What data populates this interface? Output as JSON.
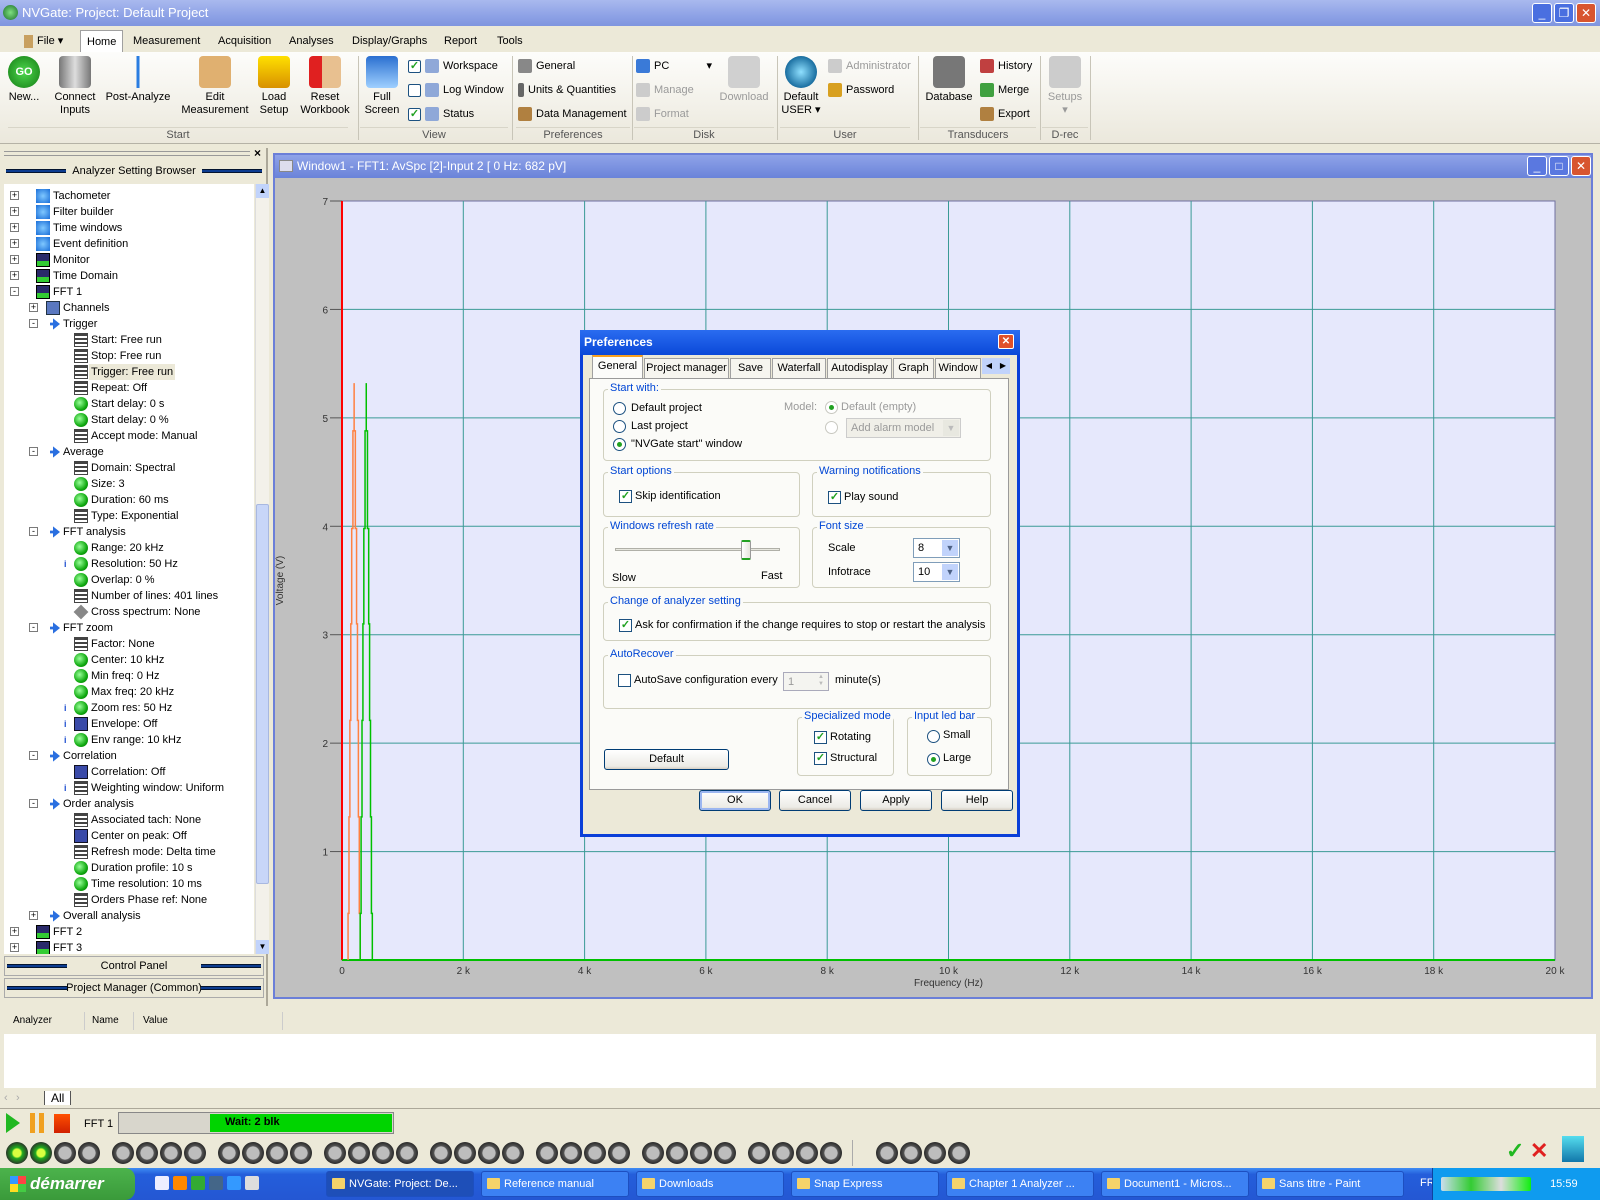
{
  "window": {
    "title": "NVGate: Project: Default Project"
  },
  "menu": {
    "file": "File",
    "tabs": [
      "Home",
      "Measurement",
      "Acquisition",
      "Analyses",
      "Display/Graphs",
      "Report",
      "Tools"
    ],
    "active": "Home"
  },
  "ribbon": {
    "start": {
      "label": "Start",
      "new": "New...",
      "connect": "Connect Inputs",
      "post": "Post-Analyze",
      "edit": "Edit Measurement",
      "load": "Load Setup",
      "reset": "Reset Workbook"
    },
    "view": {
      "label": "View",
      "full": "Full Screen",
      "workspace": "Workspace",
      "workspace_checked": true,
      "log": "Log Window",
      "log_checked": false,
      "status": "Status",
      "status_checked": true
    },
    "preferences": {
      "label": "Preferences",
      "general": "General",
      "units": "Units & Quantities",
      "data": "Data Management"
    },
    "disk": {
      "label": "Disk",
      "pc": "PC",
      "manage": "Manage",
      "format": "Format",
      "download": "Download"
    },
    "user": {
      "label": "User",
      "default": "Default USER",
      "admin": "Administrator",
      "password": "Password"
    },
    "transducers": {
      "label": "Transducers",
      "database": "Database",
      "history": "History",
      "merge": "Merge",
      "export": "Export"
    },
    "drec": {
      "label": "D-rec",
      "setups": "Setups"
    }
  },
  "left_panel": {
    "title": "Analyzer Setting Browser",
    "control_panel": "Control Panel",
    "project_manager": "Project Manager (Common)",
    "tree": [
      {
        "label": "Tachometer",
        "level": 0,
        "exp": "+",
        "icon": "gear"
      },
      {
        "label": "Filter builder",
        "level": 0,
        "exp": "+",
        "icon": "gear"
      },
      {
        "label": "Time windows",
        "level": 0,
        "exp": "+",
        "icon": "gear"
      },
      {
        "label": "Event definition",
        "level": 0,
        "exp": "+",
        "icon": "gear"
      },
      {
        "label": "Monitor",
        "level": 0,
        "exp": "+",
        "icon": "scope"
      },
      {
        "label": "Time Domain",
        "level": 0,
        "exp": "+",
        "icon": "scope"
      },
      {
        "label": "FFT 1",
        "level": 0,
        "exp": "-",
        "icon": "scope"
      },
      {
        "label": "Channels",
        "level": 1,
        "exp": "+",
        "icon": "channels"
      },
      {
        "label": "Trigger",
        "level": 1,
        "exp": "-",
        "icon": "arrow"
      },
      {
        "label": "Start: Free run",
        "level": 2,
        "icon": "list"
      },
      {
        "label": "Stop: Free run",
        "level": 2,
        "icon": "list"
      },
      {
        "label": "Trigger: Free run",
        "level": 2,
        "icon": "list",
        "selected": true
      },
      {
        "label": "Repeat: Off",
        "level": 2,
        "icon": "list"
      },
      {
        "label": "Start delay: 0 s",
        "level": 2,
        "icon": "knob"
      },
      {
        "label": "Start delay: 0 %",
        "level": 2,
        "icon": "knob"
      },
      {
        "label": "Accept mode: Manual",
        "level": 2,
        "icon": "list"
      },
      {
        "label": "Average",
        "level": 1,
        "exp": "-",
        "icon": "arrow"
      },
      {
        "label": "Domain: Spectral",
        "level": 2,
        "icon": "list"
      },
      {
        "label": "Size: 3",
        "level": 2,
        "icon": "knob"
      },
      {
        "label": "Duration: 60 ms",
        "level": 2,
        "icon": "knob"
      },
      {
        "label": "Type: Exponential",
        "level": 2,
        "icon": "list"
      },
      {
        "label": "FFT analysis",
        "level": 1,
        "exp": "-",
        "icon": "arrow"
      },
      {
        "label": "Range: 20 kHz",
        "level": 2,
        "icon": "knob"
      },
      {
        "label": "Resolution: 50 Hz",
        "level": 2,
        "icon": "knob",
        "info": true
      },
      {
        "label": "Overlap: 0 %",
        "level": 2,
        "icon": "knob"
      },
      {
        "label": "Number of lines: 401 lines",
        "level": 2,
        "icon": "list"
      },
      {
        "label": "Cross spectrum: None",
        "level": 2,
        "icon": "diamond"
      },
      {
        "label": "FFT zoom",
        "level": 1,
        "exp": "-",
        "icon": "arrow"
      },
      {
        "label": "Factor: None",
        "level": 2,
        "icon": "list"
      },
      {
        "label": "Center: 10 kHz",
        "level": 2,
        "icon": "knob"
      },
      {
        "label": "Min freq: 0 Hz",
        "level": 2,
        "icon": "knob"
      },
      {
        "label": "Max freq: 20 kHz",
        "level": 2,
        "icon": "knob"
      },
      {
        "label": "Zoom res: 50 Hz",
        "level": 2,
        "icon": "knob",
        "info": true
      },
      {
        "label": "Envelope: Off",
        "level": 2,
        "icon": "square",
        "info": true
      },
      {
        "label": "Env range: 10 kHz",
        "level": 2,
        "icon": "knob",
        "info": true
      },
      {
        "label": "Correlation",
        "level": 1,
        "exp": "-",
        "icon": "arrow"
      },
      {
        "label": "Correlation: Off",
        "level": 2,
        "icon": "square"
      },
      {
        "label": "Weighting window: Uniform",
        "level": 2,
        "icon": "list",
        "info": true
      },
      {
        "label": "Order analysis",
        "level": 1,
        "exp": "-",
        "icon": "arrow"
      },
      {
        "label": "Associated tach: None",
        "level": 2,
        "icon": "list"
      },
      {
        "label": "Center on peak: Off",
        "level": 2,
        "icon": "square"
      },
      {
        "label": "Refresh mode: Delta time",
        "level": 2,
        "icon": "list"
      },
      {
        "label": "Duration profile: 10 s",
        "level": 2,
        "icon": "knob"
      },
      {
        "label": "Time resolution: 10 ms",
        "level": 2,
        "icon": "knob"
      },
      {
        "label": "Orders Phase ref: None",
        "level": 2,
        "icon": "list"
      },
      {
        "label": "Overall analysis",
        "level": 1,
        "exp": "+",
        "icon": "arrow"
      },
      {
        "label": "FFT 2",
        "level": 0,
        "exp": "+",
        "icon": "scope"
      },
      {
        "label": "FFT 3",
        "level": 0,
        "exp": "+",
        "icon": "scope"
      }
    ]
  },
  "graph_window": {
    "title": "Window1 - FFT1: AvSpc [2]-Input 2 [ 0 Hz:  682 pV]"
  },
  "chart_data": {
    "type": "line",
    "xlabel": "Frequency (Hz)",
    "ylabel": "Voltage (V)",
    "xlim": [
      0,
      20000
    ],
    "ylim": [
      0,
      7
    ],
    "x_ticks": [
      0,
      2000,
      4000,
      6000,
      8000,
      10000,
      12000,
      14000,
      16000,
      18000,
      20000
    ],
    "x_tick_labels": [
      "0",
      "2 k",
      "4 k",
      "6 k",
      "8 k",
      "10 k",
      "12 k",
      "14 k",
      "16 k",
      "18 k",
      "20 k"
    ],
    "y_ticks": [
      1,
      2,
      3,
      4,
      5,
      6,
      7
    ],
    "y_tick_labels": [
      "1",
      "2",
      "3",
      "4",
      "5",
      "6",
      "7"
    ],
    "grid": true,
    "series": [
      {
        "color": "#ff8040",
        "x": [
          100,
          100,
          115,
          115,
          130,
          130,
          145,
          145,
          160,
          160,
          180,
          180,
          200,
          200,
          200,
          220,
          220,
          240,
          240,
          255,
          255,
          270,
          270,
          285,
          285,
          300,
          300
        ],
        "y": [
          0,
          0.43,
          0.43,
          1.32,
          1.32,
          2.21,
          2.21,
          3.1,
          3.1,
          3.98,
          3.98,
          4.88,
          4.88,
          5.32,
          4.88,
          4.88,
          3.98,
          3.98,
          3.1,
          3.1,
          2.21,
          2.21,
          1.32,
          1.32,
          0.43,
          0.43,
          0
        ]
      },
      {
        "color": "#00c000",
        "x": [
          300,
          300,
          315,
          315,
          330,
          330,
          345,
          345,
          360,
          360,
          380,
          380,
          400,
          400,
          400,
          420,
          420,
          440,
          440,
          455,
          455,
          470,
          470,
          485,
          485,
          500,
          500
        ],
        "y": [
          0,
          0.43,
          0.43,
          1.32,
          1.32,
          2.21,
          2.21,
          3.1,
          3.1,
          3.98,
          3.98,
          4.88,
          4.88,
          5.32,
          4.88,
          4.88,
          3.98,
          3.98,
          3.1,
          3.1,
          2.21,
          2.21,
          1.32,
          1.32,
          0.43,
          0.43,
          0
        ]
      }
    ]
  },
  "dialog": {
    "title": "Preferences",
    "tabs": [
      "General",
      "Project manager",
      "Save",
      "Waterfall",
      "Autodisplay",
      "Graph",
      "Window"
    ],
    "active_tab": "General",
    "start_with": {
      "legend": "Start with:",
      "options": [
        "Default project",
        "Last project",
        "\"NVGate start\" window"
      ],
      "selected": 2,
      "model_label": "Model:",
      "model_default": "Default (empty)",
      "model_combo": "Add alarm model"
    },
    "start_options": {
      "legend": "Start options",
      "skip": "Skip identification",
      "skip_checked": true
    },
    "warning": {
      "legend": "Warning notifications",
      "play": "Play sound",
      "play_checked": true
    },
    "refresh": {
      "legend": "Windows refresh rate",
      "slow": "Slow",
      "fast": "Fast",
      "value_fraction": 0.82
    },
    "font_size": {
      "legend": "Font size",
      "scale_label": "Scale",
      "scale_value": "8",
      "infotrace_label": "Infotrace",
      "infotrace_value": "10"
    },
    "change": {
      "legend": "Change of analyzer setting",
      "ask": "Ask for confirmation if the change requires to stop or restart the analysis",
      "ask_checked": true
    },
    "autorecover": {
      "legend": "AutoRecover",
      "autosave": "AutoSave configuration every",
      "autosave_checked": false,
      "minutes": "1",
      "unit": "minute(s)"
    },
    "specialized": {
      "legend": "Specialized mode",
      "rotating": "Rotating",
      "structural": "Structural"
    },
    "led_bar": {
      "legend": "Input led bar",
      "small": "Small",
      "large": "Large",
      "selected": "Large"
    },
    "buttons": {
      "default": "Default",
      "ok": "OK",
      "cancel": "Cancel",
      "apply": "Apply",
      "help": "Help"
    }
  },
  "bottom": {
    "columns": [
      "Analyzer",
      "Name",
      "Value"
    ],
    "tab": "All",
    "analyzer": "FFT 1",
    "progress_label": "Wait: 2 blk",
    "progress_fraction": 0.33,
    "active_leds": 2
  },
  "taskbar": {
    "start": "démarrer",
    "tasks": [
      "NVGate: Project: De...",
      "Reference manual",
      "Downloads",
      "Snap Express",
      "Chapter 1 Analyzer ...",
      "Document1 - Micros...",
      "Sans titre - Paint"
    ],
    "lang": "FR",
    "clock": "15:59"
  }
}
